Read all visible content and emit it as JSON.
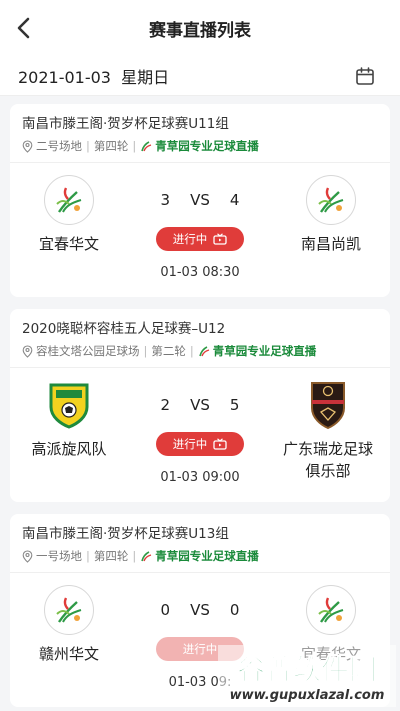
{
  "nav": {
    "title": "赛事直播列表",
    "back_icon": "chevron-left-icon"
  },
  "datebar": {
    "date": "2021-01-03  星期日",
    "calendar_icon": "calendar-icon"
  },
  "colors": {
    "live": "#e03c3a",
    "org_green": "#1a8a3a"
  },
  "matches": [
    {
      "tournament": "南昌市滕王阁·贺岁杯足球赛U11组",
      "venue": "二号场地",
      "round": "第四轮",
      "org": "青草园专业足球直播",
      "home": {
        "name": "宜春华文"
      },
      "away": {
        "name": "南昌尚凯"
      },
      "home_score": "3",
      "vs": "VS",
      "away_score": "4",
      "status": "进行中",
      "time": "01-03 08:30"
    },
    {
      "tournament": "2020晓聪杯容桂五人足球赛–U12",
      "venue": "容桂文塔公园足球场",
      "round": "第二轮",
      "org": "青草园专业足球直播",
      "home": {
        "name": "高派旋风队"
      },
      "away": {
        "name_line1": "广东瑞龙足球",
        "name_line2": "俱乐部"
      },
      "home_score": "2",
      "vs": "VS",
      "away_score": "5",
      "status": "进行中",
      "time": "01-03 09:00"
    },
    {
      "tournament": "南昌市滕王阁·贺岁杯足球赛U13组",
      "venue": "一号场地",
      "round": "第四轮",
      "org": "青草园专业足球直播",
      "home": {
        "name": "赣州华文"
      },
      "away": {
        "name": "宜春华文"
      },
      "home_score": "0",
      "vs": "VS",
      "away_score": "0",
      "status": "进行中",
      "time": "01-03 09:"
    }
  ],
  "watermark": {
    "text": "谷普软件园",
    "url": "www.gupuxlazal.com"
  }
}
